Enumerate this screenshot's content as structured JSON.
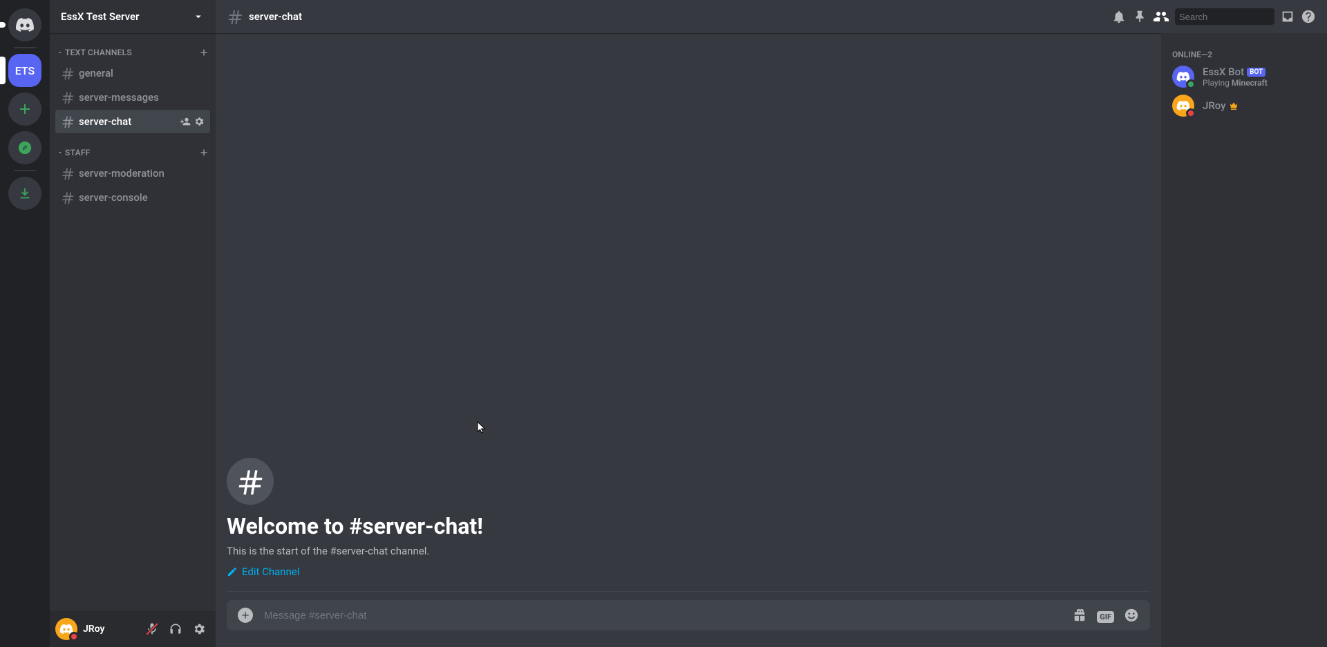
{
  "server": {
    "abbr": "ETS",
    "name": "EssX Test Server"
  },
  "categories": [
    {
      "label": "TEXT CHANNELS",
      "channels": [
        {
          "name": "general",
          "active": false
        },
        {
          "name": "server-messages",
          "active": false
        },
        {
          "name": "server-chat",
          "active": true
        }
      ]
    },
    {
      "label": "STAFF",
      "channels": [
        {
          "name": "server-moderation",
          "active": false
        },
        {
          "name": "server-console",
          "active": false
        }
      ]
    }
  ],
  "current_channel": "server-chat",
  "welcome": {
    "title": "Welcome to #server-chat!",
    "subtitle": "This is the start of the #server-chat channel.",
    "edit": "Edit Channel"
  },
  "composer": {
    "placeholder": "Message #server-chat"
  },
  "search": {
    "placeholder": "Search"
  },
  "members": {
    "heading": "ONLINE—2",
    "list": [
      {
        "name": "EssX Bot",
        "bot": true,
        "activity_prefix": "Playing ",
        "activity_name": "Minecraft",
        "status": "online"
      },
      {
        "name": "JRoy",
        "bot": false,
        "owner": true,
        "status": "dnd"
      }
    ]
  },
  "footer_user": {
    "name": "JRoy",
    "status": "dnd"
  },
  "bot_tag": "BOT",
  "gif_label": "GIF"
}
